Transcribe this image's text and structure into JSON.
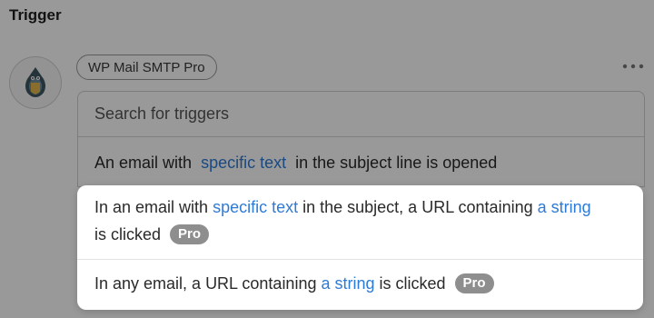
{
  "heading": "Trigger",
  "integration": {
    "name": "WP Mail SMTP Pro",
    "icon": "bird-mascot-icon"
  },
  "more_icon": "ellipsis-icon",
  "search": {
    "placeholder": "Search for triggers"
  },
  "triggers": [
    {
      "pre": "An email with",
      "link": "specific text",
      "post": "in the subject line is opened",
      "pro": false
    },
    {
      "pre": "In an email with",
      "link": "specific text",
      "mid": "in the subject, a URL containing",
      "link2": "a string",
      "post": "is clicked",
      "pro": true,
      "badge": "Pro"
    },
    {
      "pre": "In any email, a URL containing",
      "link": "a string",
      "post": "is clicked",
      "pro": true,
      "badge": "Pro"
    }
  ],
  "colors": {
    "link": "#2e7bd6",
    "badge": "#8e8e8e",
    "overlay": "rgba(0,0,0,0.40)"
  }
}
